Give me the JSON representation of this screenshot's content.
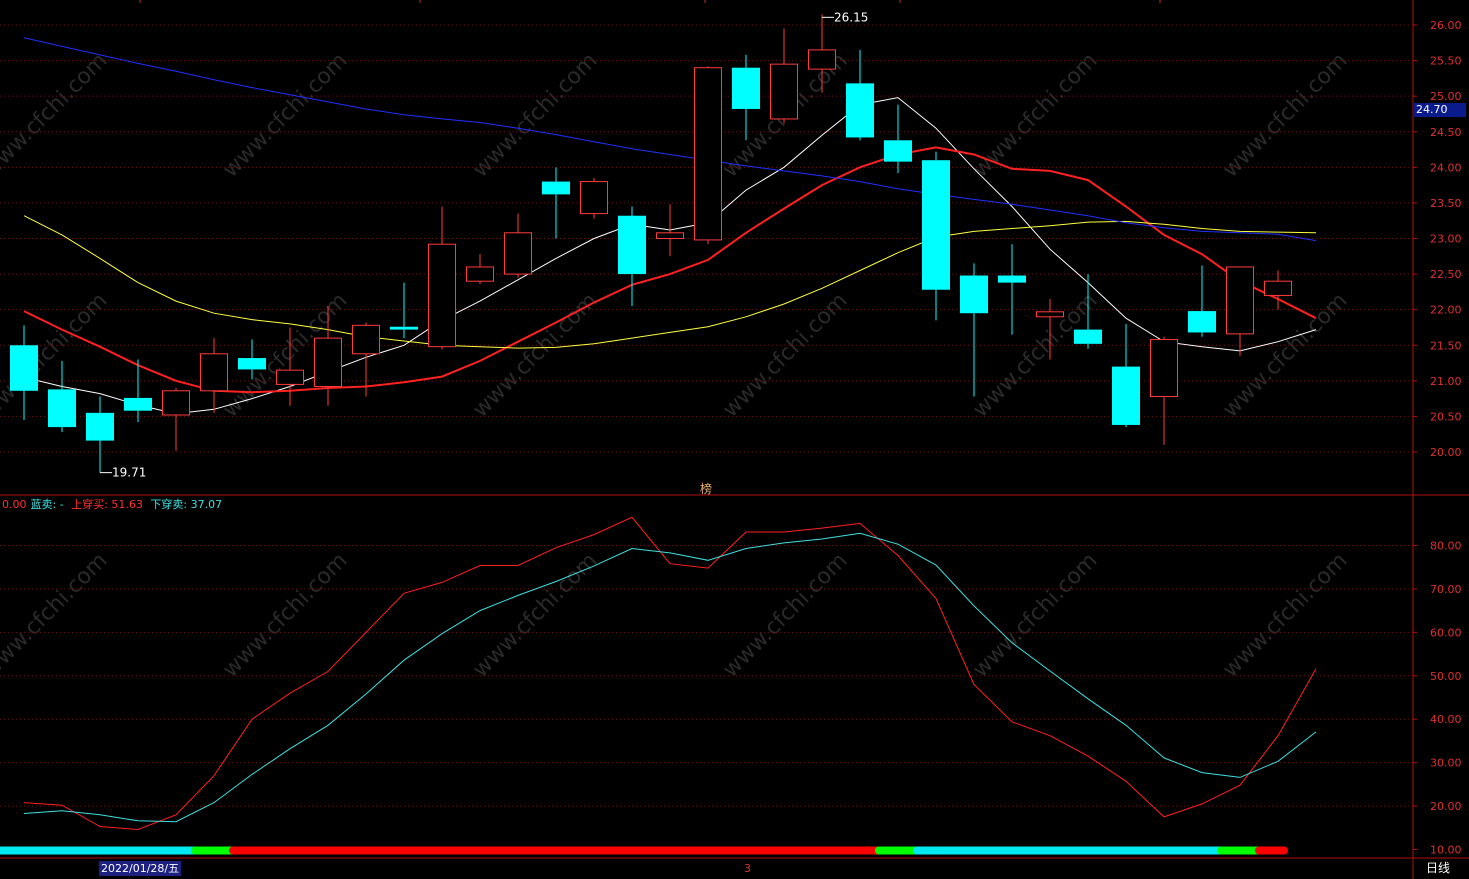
{
  "indicator_legend": {
    "first_value": "0.00",
    "blue_sell_label": "蓝卖:",
    "blue_sell_value": "-",
    "up_cross_buy_label": "上穿买:",
    "up_cross_buy_value": "51.63",
    "down_cross_sell_label": "下穿卖:",
    "down_cross_sell_value": "37.07"
  },
  "current_price_tag": "24.70",
  "date_label": "2022/01/28/五",
  "period_label": "日线",
  "bang_marker": "榜",
  "marker_3": "3",
  "watermark": "www.cfchi.com",
  "colors": {
    "up": "#ff3b3b",
    "down": "#00ffff",
    "ma_fast": "#ffffff",
    "ma_red": "#ff2020",
    "ma_yellow": "#ffff40",
    "ma_blue": "#2030ff",
    "osc_red": "#ff2020",
    "osc_cyan": "#40e0e0",
    "axis": "#b01010",
    "axis_text": "#e03030",
    "bar_cyan": "#00e8f0",
    "bar_green": "#00ff00",
    "bar_red": "#ff0000"
  },
  "chart_data": [
    {
      "type": "candlestick",
      "y_ticks": [
        20.0,
        20.5,
        21.0,
        21.5,
        22.0,
        22.5,
        23.0,
        23.5,
        24.0,
        24.5,
        25.0,
        25.5,
        26.0
      ],
      "y_tick_labels": [
        "20.00",
        "20.50",
        "21.00",
        "21.50",
        "22.00",
        "22.50",
        "23.00",
        "23.50",
        "24.00",
        "24.50",
        "25.00",
        "25.50",
        "26.00"
      ],
      "ylim": [
        19.5,
        26.3
      ],
      "annotations": [
        {
          "label": "26.15",
          "candle": 21,
          "value": 26.15
        },
        {
          "label": "19.71",
          "candle": 2,
          "value": 19.71
        }
      ],
      "candles": [
        {
          "o": 21.5,
          "h": 21.78,
          "l": 20.45,
          "c": 20.86
        },
        {
          "o": 20.88,
          "h": 21.28,
          "l": 20.28,
          "c": 20.35
        },
        {
          "o": 20.55,
          "h": 20.78,
          "l": 19.71,
          "c": 20.16
        },
        {
          "o": 20.76,
          "h": 21.3,
          "l": 20.42,
          "c": 20.58
        },
        {
          "o": 20.52,
          "h": 20.9,
          "l": 20.02,
          "c": 20.86
        },
        {
          "o": 20.86,
          "h": 21.6,
          "l": 20.55,
          "c": 21.38
        },
        {
          "o": 21.32,
          "h": 21.58,
          "l": 21.02,
          "c": 21.16
        },
        {
          "o": 20.95,
          "h": 21.75,
          "l": 20.65,
          "c": 21.15
        },
        {
          "o": 20.92,
          "h": 22.05,
          "l": 20.65,
          "c": 21.6
        },
        {
          "o": 21.38,
          "h": 21.82,
          "l": 20.78,
          "c": 21.78
        },
        {
          "o": 21.76,
          "h": 22.38,
          "l": 21.6,
          "c": 21.72
        },
        {
          "o": 21.48,
          "h": 23.45,
          "l": 21.44,
          "c": 22.92
        },
        {
          "o": 22.4,
          "h": 22.78,
          "l": 22.36,
          "c": 22.6
        },
        {
          "o": 22.5,
          "h": 23.35,
          "l": 22.45,
          "c": 23.08
        },
        {
          "o": 23.8,
          "h": 24.0,
          "l": 23.0,
          "c": 23.62
        },
        {
          "o": 23.35,
          "h": 23.85,
          "l": 23.28,
          "c": 23.8
        },
        {
          "o": 23.32,
          "h": 23.45,
          "l": 22.05,
          "c": 22.5
        },
        {
          "o": 23.0,
          "h": 23.48,
          "l": 22.75,
          "c": 23.08
        },
        {
          "o": 22.98,
          "h": 25.42,
          "l": 22.92,
          "c": 25.4
        },
        {
          "o": 25.4,
          "h": 25.58,
          "l": 24.38,
          "c": 24.82
        },
        {
          "o": 24.68,
          "h": 25.95,
          "l": 24.62,
          "c": 25.45
        },
        {
          "o": 25.38,
          "h": 26.15,
          "l": 25.05,
          "c": 25.65
        },
        {
          "o": 25.18,
          "h": 25.65,
          "l": 24.38,
          "c": 24.42
        },
        {
          "o": 24.38,
          "h": 24.88,
          "l": 23.92,
          "c": 24.08
        },
        {
          "o": 24.1,
          "h": 24.22,
          "l": 21.85,
          "c": 22.28
        },
        {
          "o": 22.48,
          "h": 22.65,
          "l": 20.78,
          "c": 21.95
        },
        {
          "o": 22.48,
          "h": 22.92,
          "l": 21.65,
          "c": 22.38
        },
        {
          "o": 21.9,
          "h": 22.15,
          "l": 21.3,
          "c": 21.97
        },
        {
          "o": 21.72,
          "h": 22.5,
          "l": 21.45,
          "c": 21.52
        },
        {
          "o": 21.2,
          "h": 21.8,
          "l": 20.35,
          "c": 20.38
        },
        {
          "o": 20.78,
          "h": 21.62,
          "l": 20.1,
          "c": 21.58
        },
        {
          "o": 21.98,
          "h": 22.62,
          "l": 21.62,
          "c": 21.68
        },
        {
          "o": 21.66,
          "h": 22.6,
          "l": 21.35,
          "c": 22.6
        },
        {
          "o": 22.2,
          "h": 22.55,
          "l": 22.0,
          "c": 22.4
        }
      ],
      "series": [
        {
          "color_key": "ma_fast",
          "values": [
            21.05,
            20.92,
            20.82,
            20.66,
            20.54,
            20.6,
            20.75,
            20.92,
            21.13,
            21.33,
            21.5,
            21.85,
            22.12,
            22.42,
            22.72,
            23.0,
            23.2,
            23.12,
            23.22,
            23.68,
            24.0,
            24.45,
            24.88,
            24.98,
            24.55,
            23.98,
            23.45,
            22.85,
            22.38,
            21.88,
            21.55,
            21.48,
            21.42,
            21.55,
            21.72
          ]
        },
        {
          "color_key": "ma_red",
          "values": [
            21.98,
            21.72,
            21.48,
            21.22,
            21.0,
            20.86,
            20.84,
            20.86,
            20.9,
            20.92,
            20.98,
            21.06,
            21.28,
            21.55,
            21.82,
            22.1,
            22.35,
            22.5,
            22.7,
            23.08,
            23.42,
            23.75,
            24.0,
            24.18,
            24.28,
            24.18,
            23.98,
            23.95,
            23.82,
            23.45,
            23.05,
            22.78,
            22.4,
            22.15,
            21.88
          ]
        },
        {
          "color_key": "ma_yellow",
          "values": [
            23.32,
            23.05,
            22.72,
            22.38,
            22.12,
            21.95,
            21.86,
            21.8,
            21.72,
            21.62,
            21.56,
            21.5,
            21.48,
            21.46,
            21.47,
            21.52,
            21.6,
            21.68,
            21.76,
            21.9,
            22.08,
            22.3,
            22.55,
            22.8,
            23.02,
            23.1,
            23.14,
            23.18,
            23.23,
            23.24,
            23.2,
            23.14,
            23.1,
            23.09,
            23.08
          ]
        },
        {
          "color_key": "ma_blue",
          "values": [
            25.82,
            25.7,
            25.58,
            25.46,
            25.35,
            25.23,
            25.12,
            25.02,
            24.92,
            24.82,
            24.74,
            24.68,
            24.63,
            24.55,
            24.46,
            24.36,
            24.26,
            24.18,
            24.1,
            24.02,
            23.95,
            23.88,
            23.8,
            23.7,
            23.62,
            23.55,
            23.48,
            23.4,
            23.32,
            23.22,
            23.15,
            23.1,
            23.08,
            23.06,
            22.97
          ]
        }
      ]
    },
    {
      "type": "line",
      "ylim": [
        8.0,
        90.0
      ],
      "y_ticks": [
        10,
        20,
        30,
        40,
        50,
        60,
        70,
        80
      ],
      "y_tick_labels": [
        "10.00",
        "20.00",
        "30.00",
        "40.00",
        "50.00",
        "60.00",
        "70.00",
        "80.00"
      ],
      "series": [
        {
          "color_key": "osc_red",
          "values": [
            20.8,
            20.2,
            15.3,
            14.6,
            18.0,
            27.0,
            40.0,
            46.0,
            51.0,
            60.0,
            69.0,
            71.5,
            75.4,
            75.4,
            79.5,
            82.5,
            86.5,
            75.8,
            74.8,
            83.1,
            83.1,
            84.0,
            85.1,
            77.7,
            67.8,
            48.0,
            39.4,
            36.2,
            31.5,
            25.7,
            17.5,
            20.5,
            24.8,
            36.2,
            51.63
          ]
        },
        {
          "color_key": "osc_cyan",
          "values": [
            18.3,
            18.9,
            18.0,
            16.6,
            16.4,
            20.8,
            27.3,
            33.2,
            38.6,
            45.8,
            53.6,
            59.7,
            65.0,
            68.5,
            71.7,
            75.3,
            79.3,
            78.3,
            76.6,
            79.3,
            80.6,
            81.5,
            82.8,
            80.3,
            75.5,
            66.1,
            57.6,
            51.1,
            44.7,
            38.6,
            31.1,
            27.7,
            26.6,
            30.3,
            37.07
          ]
        }
      ],
      "signal_bar": [
        {
          "color_key": "bar_cyan",
          "from": 0,
          "to": 5
        },
        {
          "color_key": "bar_green",
          "from": 5,
          "to": 6
        },
        {
          "color_key": "bar_red",
          "from": 6,
          "to": 23
        },
        {
          "color_key": "bar_green",
          "from": 23,
          "to": 24
        },
        {
          "color_key": "bar_cyan",
          "from": 24,
          "to": 32
        },
        {
          "color_key": "bar_green",
          "from": 32,
          "to": 33
        },
        {
          "color_key": "bar_red",
          "from": 33,
          "to": 34
        }
      ]
    }
  ]
}
